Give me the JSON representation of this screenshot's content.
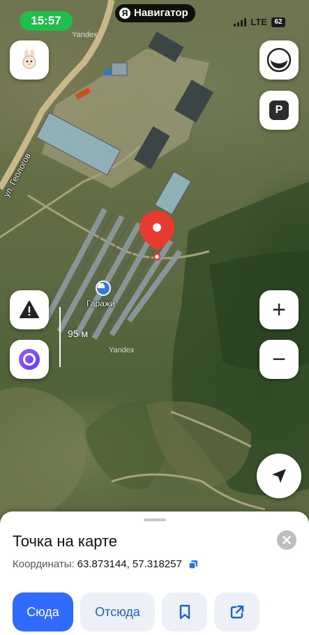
{
  "status_bar": {
    "time": "15:57",
    "app_badge_letter": "Я",
    "app_badge_label": "Навигатор",
    "network": "LTE",
    "battery": "62"
  },
  "map": {
    "place_label": "Гаражи",
    "street_label": "ул. Геологов",
    "scale_label": "95 м",
    "watermark": "Yandex",
    "pin_color": "#e83a2f"
  },
  "map_controls": {
    "profile_icon": "rabbit-avatar-icon",
    "layers_icon": "layers-icon",
    "parking_label": "P",
    "alert_icon": "warning-triangle-icon",
    "alice_icon": "alice-assistant-icon",
    "zoom_in_label": "+",
    "zoom_out_label": "−",
    "locate_icon": "navigation-arrow-icon"
  },
  "sheet": {
    "title": "Точка на карте",
    "coords_label": "Координаты:",
    "coords_value": "63.873144, 57.318257",
    "actions": {
      "here": "Сюда",
      "from_here": "Отсюда",
      "bookmark_icon": "bookmark-icon",
      "share_icon": "share-icon"
    }
  },
  "colors": {
    "primary": "#2f6bff",
    "status_time_bg": "#1fbf4b"
  }
}
